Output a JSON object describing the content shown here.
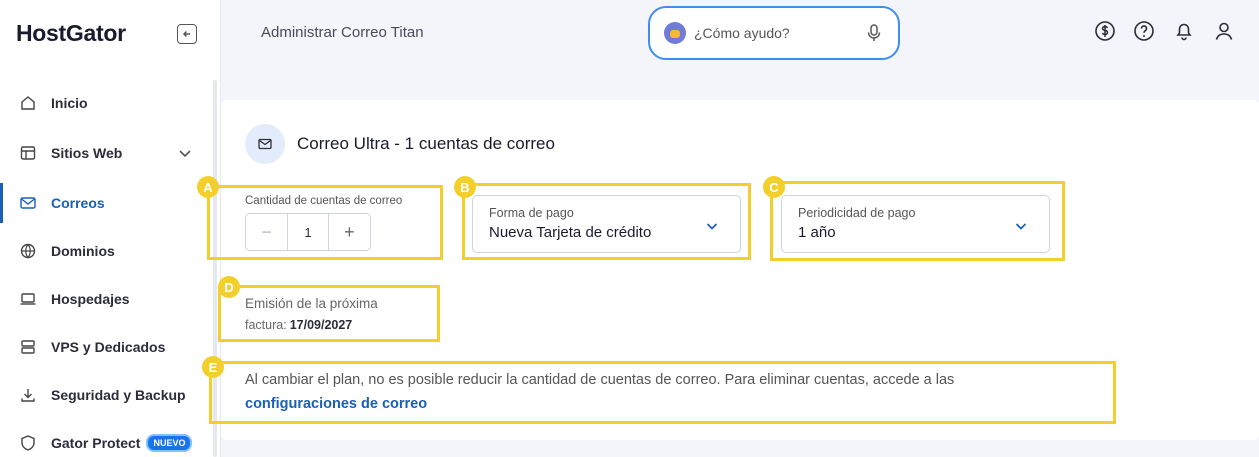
{
  "brand": {
    "name": "HostGator"
  },
  "sidebar": {
    "items": [
      {
        "label": "Inicio",
        "icon": "home-icon"
      },
      {
        "label": "Sitios Web",
        "icon": "layout-icon",
        "expandable": true
      },
      {
        "label": "Correos",
        "icon": "mail-icon",
        "active": true
      },
      {
        "label": "Dominios",
        "icon": "globe-icon"
      },
      {
        "label": "Hospedajes",
        "icon": "laptop-icon"
      },
      {
        "label": "VPS y Dedicados",
        "icon": "server-icon"
      },
      {
        "label": "Seguridad y Backup",
        "icon": "download-icon"
      },
      {
        "label": "Gator Protect",
        "icon": "shield-icon",
        "badge": "NUEVO"
      }
    ]
  },
  "header": {
    "title": "Administrar Correo Titan",
    "search": {
      "placeholder": "¿Cómo ayudo?"
    },
    "icons": [
      "dollar-icon",
      "help-icon",
      "bell-icon",
      "user-icon"
    ]
  },
  "main": {
    "title": "Correo Ultra - 1 cuentas de correo",
    "quantity": {
      "label": "Cantidad de cuentas de correo",
      "value": "1",
      "minus": "−",
      "plus": "+"
    },
    "payment_method": {
      "label": "Forma de pago",
      "value": "Nueva Tarjeta de crédito"
    },
    "payment_period": {
      "label": "Periodicidad de pago",
      "value": "1 año"
    },
    "next_invoice": {
      "line1": "Emisión de la próxima",
      "line2": "factura:",
      "date": "17/09/2027"
    },
    "note": "Al cambiar el plan, no es posible reducir la cantidad de cuentas de correo. Para eliminar cuentas, accede a las",
    "note_link": "configuraciones de correo"
  },
  "annotations": {
    "markers": [
      "A",
      "B",
      "C",
      "D",
      "E"
    ],
    "color": "#f2cf2b"
  },
  "colors": {
    "accent": "#1a5fb4",
    "search_border": "#3d8ef0",
    "badge": "#1a73e8"
  }
}
